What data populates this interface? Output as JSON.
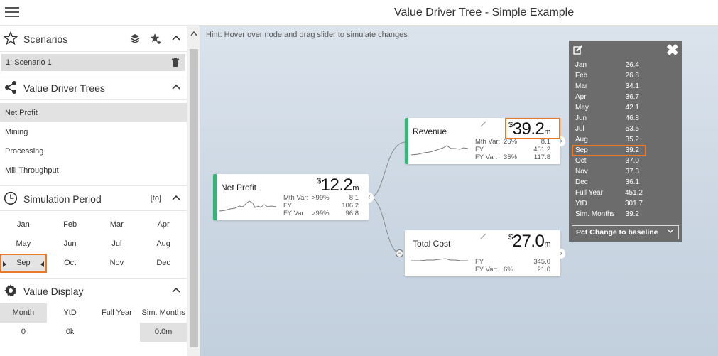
{
  "header": {
    "title": "Value Driver Tree - Simple Example"
  },
  "sidebar": {
    "scenarios": {
      "title": "Scenarios",
      "items": [
        "1: Scenario 1"
      ]
    },
    "trees": {
      "title": "Value Driver Trees",
      "items": [
        "Net Profit",
        "Mining",
        "Processing",
        "Mill Throughput"
      ],
      "active": "Net Profit"
    },
    "period": {
      "title": "Simulation Period",
      "to_label": "[to]",
      "months": [
        "Jan",
        "Feb",
        "Mar",
        "Apr",
        "May",
        "Jun",
        "Jul",
        "Aug",
        "Sep",
        "Oct",
        "Nov",
        "Dec"
      ],
      "selected": "Sep"
    },
    "value_display": {
      "title": "Value Display",
      "options": [
        "Month",
        "YtD",
        "Full Year",
        "Sim. Months"
      ],
      "selected": "Month",
      "values": [
        "0",
        "0k",
        "",
        "0.0m"
      ]
    }
  },
  "canvas": {
    "hint": "Hint: Hover over node and drag slider to simulate changes",
    "nodes": {
      "net_profit": {
        "title": "Net Profit",
        "currency": "$",
        "value": "12.2",
        "unit": "m",
        "rows": [
          {
            "k": "Mth Var:",
            "m": ">99%",
            "v": "8.1"
          },
          {
            "k": "FY",
            "m": "",
            "v": "106.2"
          },
          {
            "k": "FY Var:",
            "m": ">99%",
            "v": "96.8"
          }
        ]
      },
      "revenue": {
        "title": "Revenue",
        "currency": "$",
        "value": "39.2",
        "unit": "m",
        "rows": [
          {
            "k": "Mth Var:",
            "m": "26%",
            "v": "8.1"
          },
          {
            "k": "FY",
            "m": "",
            "v": "451.2"
          },
          {
            "k": "FY Var:",
            "m": "35%",
            "v": "117.8"
          }
        ]
      },
      "total_cost": {
        "title": "Total Cost",
        "currency": "$",
        "value": "27.0",
        "unit": "m",
        "rows": [
          {
            "k": "FY",
            "m": "",
            "v": "345.0"
          },
          {
            "k": "FY Var:",
            "m": "6%",
            "v": "21.0"
          }
        ]
      }
    },
    "popup": {
      "rows": [
        {
          "k": "Jan",
          "v": "26.4"
        },
        {
          "k": "Feb",
          "v": "26.8"
        },
        {
          "k": "Mar",
          "v": "34.1"
        },
        {
          "k": "Apr",
          "v": "36.7"
        },
        {
          "k": "May",
          "v": "42.1"
        },
        {
          "k": "Jun",
          "v": "46.8"
        },
        {
          "k": "Jul",
          "v": "53.5"
        },
        {
          "k": "Aug",
          "v": "35.2"
        },
        {
          "k": "Sep",
          "v": "39.2"
        },
        {
          "k": "Oct",
          "v": "37.0"
        },
        {
          "k": "Nov",
          "v": "37.3"
        },
        {
          "k": "Dec",
          "v": "36.1"
        },
        {
          "k": "Full Year",
          "v": "451.2"
        },
        {
          "k": "YtD",
          "v": "301.7"
        },
        {
          "k": "Sim. Months",
          "v": "39.2"
        }
      ],
      "highlighted": "Sep",
      "dropdown": "Pct Change to baseline"
    }
  },
  "colors": {
    "accent": "#3bb27a",
    "highlight": "#e8782a",
    "popup_bg": "#6c6c6c"
  }
}
